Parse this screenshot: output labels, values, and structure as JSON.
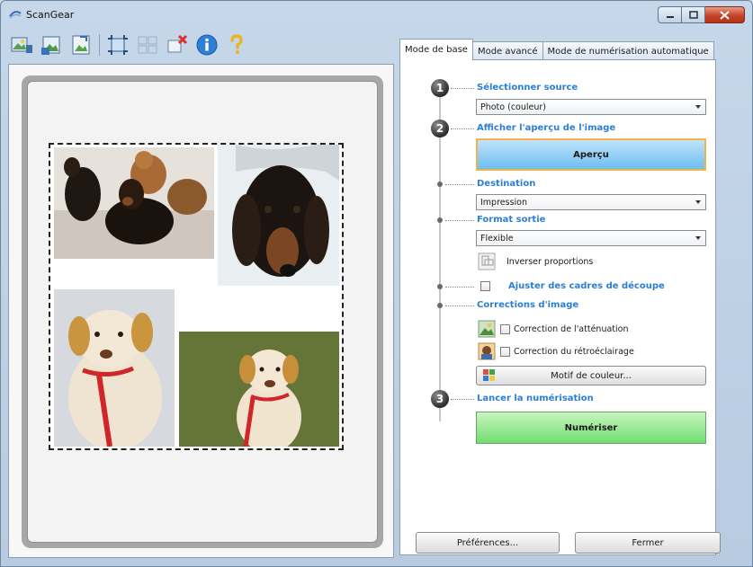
{
  "window": {
    "title": "ScanGear"
  },
  "toolbar": {
    "icons": [
      "scan-photo-icon",
      "scan-to-image-icon",
      "thumbnail-icon",
      "crop-icon",
      "select-all-icon",
      "clear-frame-icon",
      "info-icon",
      "help-icon"
    ]
  },
  "tabs": [
    {
      "label": "Mode de base",
      "active": true
    },
    {
      "label": "Mode avancé",
      "active": false
    },
    {
      "label": "Mode de numérisation automatique",
      "active": false
    }
  ],
  "steps": {
    "step1": {
      "number": "1",
      "label": "Sélectionner source",
      "select_value": "Photo (couleur)"
    },
    "step2": {
      "number": "2",
      "label": "Afficher l'aperçu de l'image",
      "preview_button": "Aperçu"
    },
    "destination": {
      "label": "Destination",
      "select_value": "Impression"
    },
    "format": {
      "label": "Format sortie",
      "select_value": "Flexible",
      "invert_label": "Inverser proportions"
    },
    "crop": {
      "label": "Ajuster des cadres de découpe"
    },
    "corrections": {
      "label": "Corrections d'image",
      "fade_label": "Correction de l'atténuation",
      "backlight_label": "Correction du rétroéclairage",
      "color_button": "Motif de couleur..."
    },
    "step3": {
      "number": "3",
      "label": "Lancer la numérisation",
      "scan_button": "Numériser"
    }
  },
  "footer": {
    "preferences_button": "Préférences...",
    "close_button": "Fermer"
  },
  "colors": {
    "accent_label": "#2a7fd4",
    "preview_btn_border": "#f0b44a",
    "scan_btn": "#6fde6f"
  }
}
